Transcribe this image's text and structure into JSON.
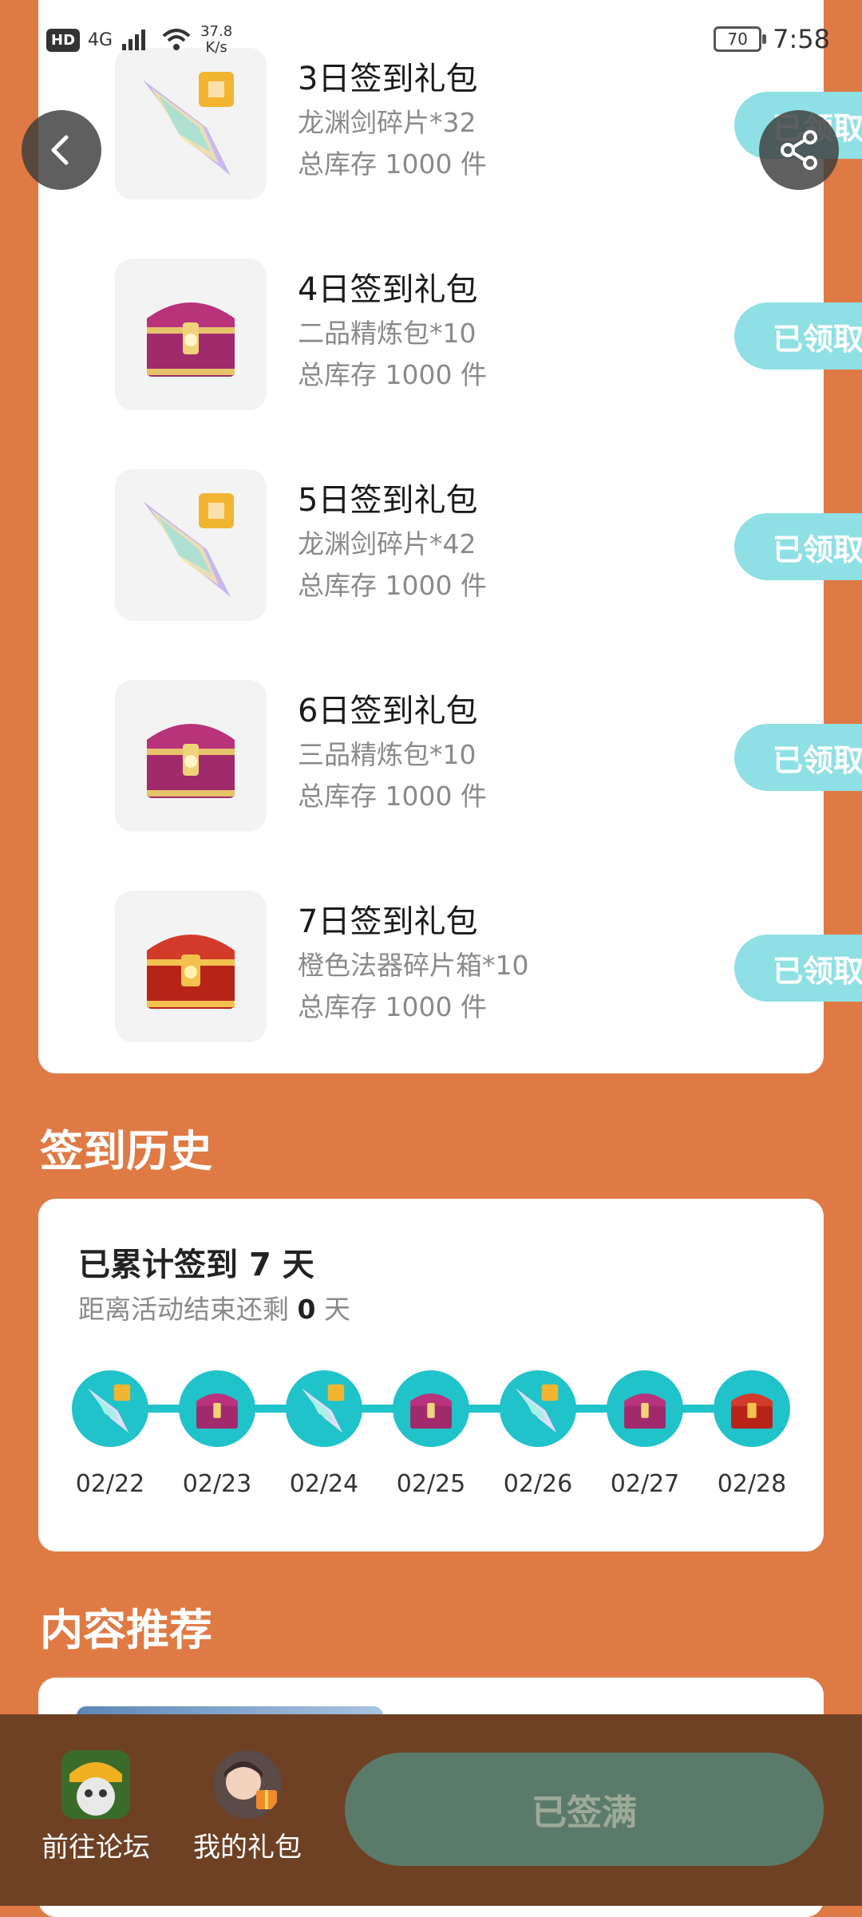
{
  "status_bar": {
    "hd": "HD",
    "network": "4G",
    "speed_value": "37.8",
    "speed_unit": "K/s",
    "battery": "70",
    "time": "7:58"
  },
  "gifts": [
    {
      "title": "3日签到礼包",
      "item": "龙渊剑碎片*32",
      "stock": "总库存 1000 件",
      "button": "已领取",
      "icon": "sword-fragment"
    },
    {
      "title": "4日签到礼包",
      "item": "二品精炼包*10",
      "stock": "总库存 1000 件",
      "button": "已领取",
      "icon": "purple-chest"
    },
    {
      "title": "5日签到礼包",
      "item": "龙渊剑碎片*42",
      "stock": "总库存 1000 件",
      "button": "已领取",
      "icon": "sword-fragment"
    },
    {
      "title": "6日签到礼包",
      "item": "三品精炼包*10",
      "stock": "总库存 1000 件",
      "button": "已领取",
      "icon": "purple-chest"
    },
    {
      "title": "7日签到礼包",
      "item": "橙色法器碎片箱*10",
      "stock": "总库存 1000 件",
      "button": "已领取",
      "icon": "red-chest"
    }
  ],
  "history": {
    "section_title": "签到历史",
    "total_prefix": "已累计签到 ",
    "total_days": "7",
    "total_suffix": " 天",
    "remain_prefix": "距离活动结束还剩 ",
    "remain_days": "0",
    "remain_suffix": " 天",
    "dates": [
      "02/22",
      "02/23",
      "02/24",
      "02/25",
      "02/26",
      "02/27",
      "02/28"
    ]
  },
  "recommend": {
    "section_title": "内容推荐"
  },
  "bottom": {
    "forum_label": "前往论坛",
    "gifts_label": "我的礼包",
    "signed_label": "已签满"
  },
  "colors": {
    "page_bg": "#DF7A44",
    "claim_button": "#8FE0E4",
    "timeline": "#20C3C9",
    "bottom_bar": "#6E4125",
    "signed_button": "#5B7B6A"
  }
}
